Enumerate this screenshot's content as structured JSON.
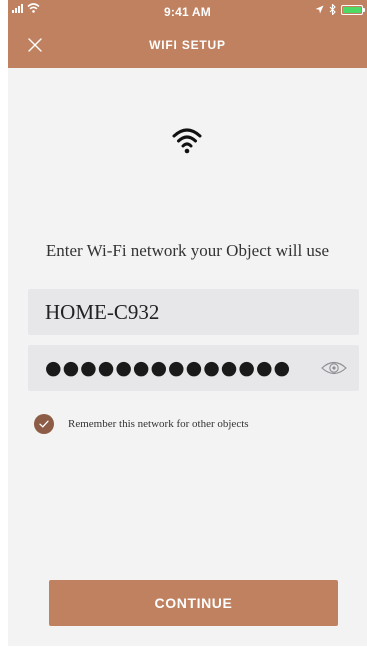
{
  "status_bar": {
    "time": "9:41 AM",
    "battery_color": "#4cd964"
  },
  "header": {
    "title": "WIFI SETUP",
    "close_icon": "close-icon",
    "background": "#bf8160"
  },
  "main": {
    "wifi_icon": "wifi-icon",
    "prompt": "Enter Wi-Fi network your Object will use",
    "network_name": {
      "value": "HOME-C932"
    },
    "password": {
      "masked": "●●●●●●●●●●●●●●",
      "toggle_icon": "eye-icon"
    },
    "remember": {
      "label": "Remember this network for other objects",
      "checked": true,
      "check_color": "#8d5c46"
    },
    "continue_label": "CONTINUE"
  },
  "colors": {
    "accent": "#bf8160",
    "field_bg": "#e7e7ea",
    "page_bg": "#f3f3f3"
  }
}
